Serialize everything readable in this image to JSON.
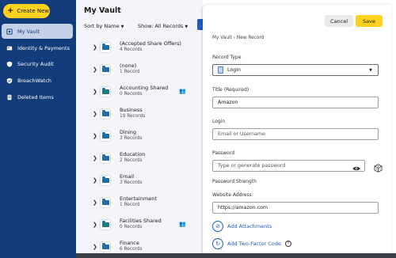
{
  "sidebar": {
    "create_label": "Create New",
    "items": [
      {
        "label": "My Vault",
        "icon": "vault-icon",
        "active": true
      },
      {
        "label": "Identity & Payments",
        "icon": "id-card-icon",
        "active": false
      },
      {
        "label": "Security Audit",
        "icon": "shield-icon",
        "active": false
      },
      {
        "label": "BreachWatch",
        "icon": "breachwatch-icon",
        "active": false
      },
      {
        "label": "Deleted Items",
        "icon": "trash-icon",
        "active": false
      }
    ]
  },
  "vault": {
    "title": "My Vault",
    "sort_label": "Sort by Name",
    "show_label": "Show: All Records",
    "folders": [
      {
        "name": "(Accepted Share Offers)",
        "count": "4 Records",
        "shared": false
      },
      {
        "name": "(none)",
        "count": "1 Record",
        "shared": false
      },
      {
        "name": "Accounting Shared",
        "count": "0 Records",
        "shared": true
      },
      {
        "name": "Business",
        "count": "19 Records",
        "shared": false
      },
      {
        "name": "Dining",
        "count": "3 Records",
        "shared": false
      },
      {
        "name": "Education",
        "count": "2 Records",
        "shared": false
      },
      {
        "name": "Email",
        "count": "3 Records",
        "shared": false
      },
      {
        "name": "Entertainment",
        "count": "1 Record",
        "shared": false
      },
      {
        "name": "Facilities Shared",
        "count": "0 Records",
        "shared": true
      },
      {
        "name": "Finance",
        "count": "6 Records",
        "shared": false
      }
    ]
  },
  "panel": {
    "cancel_label": "Cancel",
    "save_label": "Save",
    "breadcrumb": {
      "root": "My Vault",
      "sep": "›",
      "current": "New Record"
    },
    "record_type_label": "Record Type",
    "record_type_value": "Login",
    "title_label": "Title (Required)",
    "title_value": "Amazon",
    "login_label": "Login",
    "login_placeholder": "Email or Username",
    "password_label": "Password",
    "password_placeholder": "Type or generate password",
    "password_strength_label": "Password Strength",
    "website_label": "Website Address",
    "website_value": "https://amazon.com",
    "add_attachments": "Add Attachments",
    "add_2fa": "Add Two-Factor Code"
  },
  "colors": {
    "sidebar_bg": "#123c7a",
    "accent_yellow": "#ffd21f",
    "link_blue": "#1f5cc2"
  }
}
